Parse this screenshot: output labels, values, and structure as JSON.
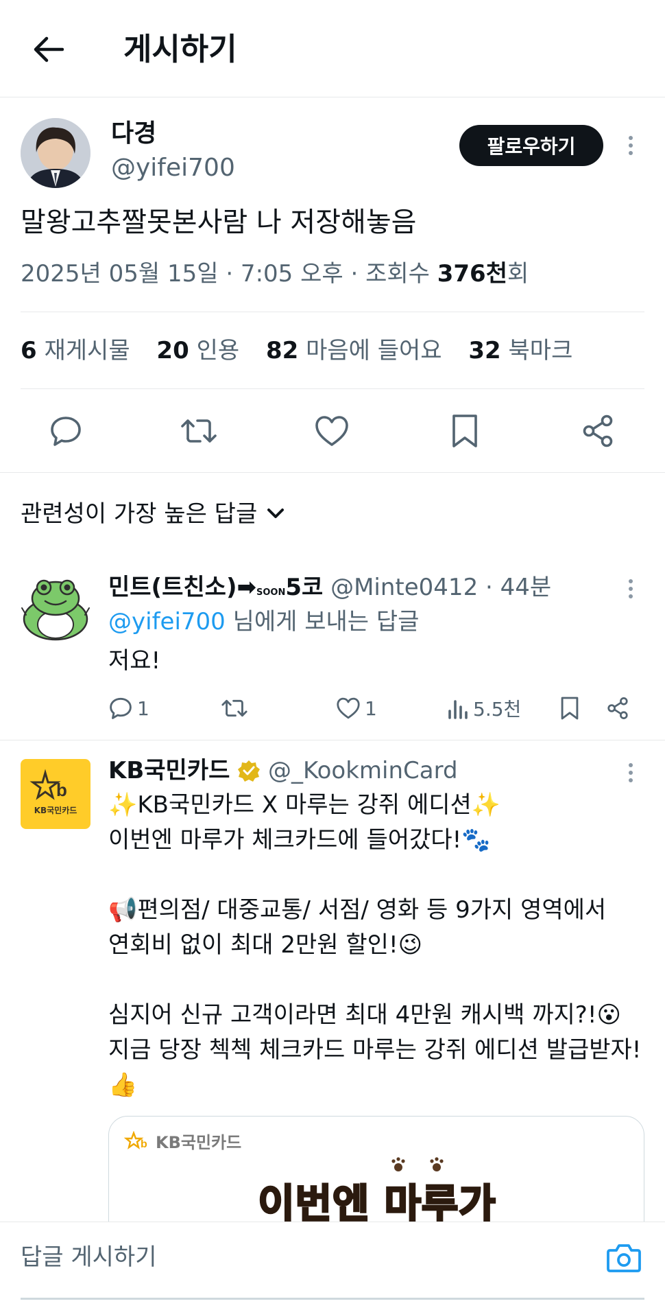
{
  "header": {
    "title": "게시하기",
    "back_icon": "arrow-left-icon"
  },
  "tweet": {
    "author_name": "다경",
    "author_handle": "@yifei700",
    "follow_label": "팔로우하기",
    "text": "말왕고추짤못본사람 나 저장해놓음",
    "date_time": "2025년 05월 15일 · 7:05 오후 · 조회수 ",
    "views_value": "376천",
    "views_suffix": "회",
    "stats": [
      {
        "value": "6",
        "label": "재게시물"
      },
      {
        "value": "20",
        "label": "인용"
      },
      {
        "value": "82",
        "label": "마음에 들어요"
      },
      {
        "value": "32",
        "label": "북마크"
      }
    ],
    "actions": [
      "reply-icon",
      "retweet-icon",
      "like-icon",
      "bookmark-icon",
      "share-icon"
    ]
  },
  "sort": {
    "label": "관련성이 가장 높은 답글",
    "icon": "chevron-down-icon"
  },
  "replies": [
    {
      "name": "민트(트친소)",
      "name_arrow": "➡",
      "name_soon": "SOON",
      "name_suffix": "5코",
      "handle_time": "@Minte0412 · 44분",
      "reply_to_handle": "@yifei700",
      "reply_to_suffix": " 님에게 보내는 답글",
      "text": "저요!",
      "reply_count": "1",
      "like_count": "1",
      "view_count": "5.5천"
    },
    {
      "name": "KB국민카드",
      "handle": "@_KookminCard",
      "verified_color": "#e2b719",
      "logo_text": "KB국민카드",
      "lines": [
        "✨KB국민카드 X 마루는 강쥐 에디션✨",
        "이번엔 마루가 체크카드에 들어갔다!🐾",
        "",
        "📢편의점/ 대중교통/ 서점/ 영화 등 9가지 영역에서",
        "연회비 없이 최대 2만원 할인!😉",
        "",
        "심지어 신규 고객이라면 최대 4만원 캐시백 까지?!😮",
        "지금 당장 첵첵 체크카드 마루는 강쥐 에디션 발급받자!",
        "👍"
      ],
      "card_brand": "KB국민카드",
      "card_headline": "이번엔 마루가"
    }
  ],
  "composer": {
    "placeholder": "답글 게시하기",
    "icon": "camera-icon"
  },
  "colors": {
    "accent": "#1d9bf0",
    "text": "#0f1419",
    "muted": "#536471",
    "kb_yellow": "#ffcc29"
  }
}
